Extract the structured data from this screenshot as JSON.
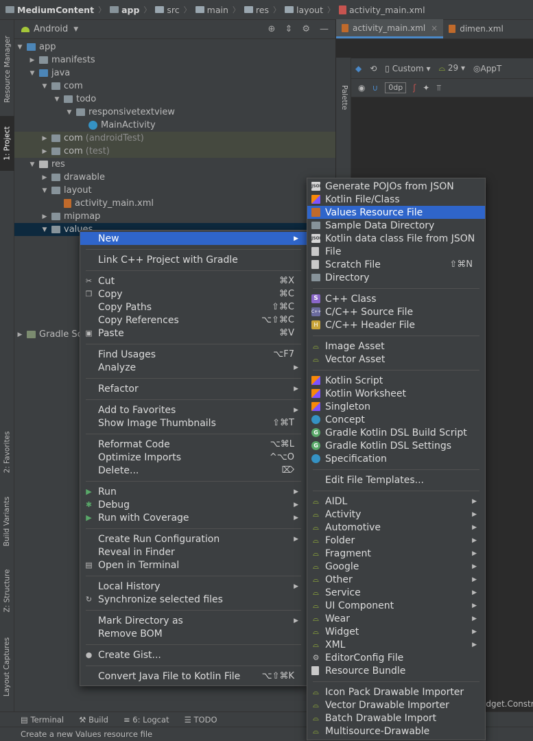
{
  "breadcrumb": [
    "MediumContent",
    "app",
    "src",
    "main",
    "res",
    "layout",
    "activity_main.xml"
  ],
  "project_panel": {
    "view_mode": "Android",
    "tree": [
      {
        "label": "app",
        "depth": 0,
        "expanded": true,
        "icon": "folder-blue"
      },
      {
        "label": "manifests",
        "depth": 1,
        "expanded": false,
        "icon": "folder"
      },
      {
        "label": "java",
        "depth": 1,
        "expanded": true,
        "icon": "folder-blue"
      },
      {
        "label": "com",
        "depth": 2,
        "expanded": true,
        "icon": "folder"
      },
      {
        "label": "todo",
        "depth": 3,
        "expanded": true,
        "icon": "folder"
      },
      {
        "label": "responsivetextview",
        "depth": 4,
        "expanded": true,
        "icon": "folder"
      },
      {
        "label": "MainActivity",
        "depth": 5,
        "icon": "class"
      },
      {
        "label": "com",
        "suffix": "(androidTest)",
        "depth": 2,
        "expanded": false,
        "icon": "folder",
        "state": "test"
      },
      {
        "label": "com",
        "suffix": "(test)",
        "depth": 2,
        "expanded": false,
        "icon": "folder",
        "state": "test"
      },
      {
        "label": "res",
        "depth": 1,
        "expanded": true,
        "icon": "res"
      },
      {
        "label": "drawable",
        "depth": 2,
        "expanded": false,
        "icon": "folder"
      },
      {
        "label": "layout",
        "depth": 2,
        "expanded": true,
        "icon": "folder"
      },
      {
        "label": "activity_main.xml",
        "depth": 3,
        "icon": "xml"
      },
      {
        "label": "mipmap",
        "depth": 2,
        "expanded": false,
        "icon": "folder"
      },
      {
        "label": "values",
        "depth": 2,
        "expanded": true,
        "icon": "folder",
        "state": "selected"
      }
    ],
    "gradle_label": "Gradle Sc"
  },
  "left_stripe": {
    "resource_manager": "Resource Manager",
    "project": "1: Project",
    "favorites": "2: Favorites",
    "build_variants": "Build Variants",
    "structure": "Z: Structure",
    "layout_captures": "Layout Captures"
  },
  "editor": {
    "tabs": [
      "activity_main.xml",
      "dimen.xml"
    ],
    "palette_label": "Palette",
    "device_label": "Custom",
    "api_label": "29",
    "theme_label": "AppT",
    "dp_value": "0dp",
    "constraint_text": "idget.Constra"
  },
  "context_menu": {
    "items": [
      {
        "label": "New",
        "arrow": true,
        "highlighted": true
      },
      {
        "sep": true
      },
      {
        "label": "Link C++ Project with Gradle"
      },
      {
        "sep": true
      },
      {
        "label": "Cut",
        "shortcut": "⌘X",
        "icon": "scissors-icon",
        "glyph": "✂"
      },
      {
        "label": "Copy",
        "shortcut": "⌘C",
        "icon": "copy-icon",
        "glyph": "❐"
      },
      {
        "label": "Copy Paths",
        "shortcut": "⇧⌘C"
      },
      {
        "label": "Copy References",
        "shortcut": "⌥⇧⌘C"
      },
      {
        "label": "Paste",
        "shortcut": "⌘V",
        "icon": "paste-icon",
        "glyph": "▣"
      },
      {
        "sep": true
      },
      {
        "label": "Find Usages",
        "shortcut": "⌥F7"
      },
      {
        "label": "Analyze",
        "arrow": true
      },
      {
        "sep": true
      },
      {
        "label": "Refactor",
        "arrow": true
      },
      {
        "sep": true
      },
      {
        "label": "Add to Favorites",
        "arrow": true
      },
      {
        "label": "Show Image Thumbnails",
        "shortcut": "⇧⌘T"
      },
      {
        "sep": true
      },
      {
        "label": "Reformat Code",
        "shortcut": "⌥⌘L"
      },
      {
        "label": "Optimize Imports",
        "shortcut": "^⌥O"
      },
      {
        "label": "Delete...",
        "shortcut": "⌦"
      },
      {
        "sep": true
      },
      {
        "label": "Run",
        "arrow": true,
        "icon": "run-icon",
        "glyph": "▶",
        "iconClass": "green"
      },
      {
        "label": "Debug",
        "arrow": true,
        "icon": "debug-icon",
        "glyph": "✱",
        "iconClass": "green"
      },
      {
        "label": "Run with Coverage",
        "arrow": true,
        "icon": "coverage-icon",
        "glyph": "▶",
        "iconClass": "green"
      },
      {
        "sep": true
      },
      {
        "label": "Create Run Configuration",
        "arrow": true
      },
      {
        "label": "Reveal in Finder"
      },
      {
        "label": "Open in Terminal",
        "icon": "terminal-icon",
        "glyph": "▤"
      },
      {
        "sep": true
      },
      {
        "label": "Local History",
        "arrow": true
      },
      {
        "label": "Synchronize selected files",
        "icon": "sync-icon",
        "glyph": "↻"
      },
      {
        "sep": true
      },
      {
        "label": "Mark Directory as",
        "arrow": true
      },
      {
        "label": "Remove BOM"
      },
      {
        "sep": true
      },
      {
        "label": "Create Gist...",
        "icon": "github-icon",
        "glyph": "●"
      },
      {
        "sep": true
      },
      {
        "label": "Convert Java File to Kotlin File",
        "shortcut": "⌥⇧⌘K"
      }
    ]
  },
  "new_submenu": {
    "items": [
      {
        "label": "Generate POJOs from JSON",
        "icon": "json-icon",
        "iconClass": "json",
        "glyph": "JSON"
      },
      {
        "label": "Kotlin File/Class",
        "icon": "kotlin-icon",
        "iconClass": "kotlin"
      },
      {
        "label": "Values Resource File",
        "icon": "xml-file-icon",
        "iconClass": "xml",
        "highlighted": true
      },
      {
        "label": "Sample Data Directory",
        "icon": "folder-icon",
        "iconClass": "folder"
      },
      {
        "label": "Kotlin data class File from JSON",
        "icon": "kotlin-json-icon",
        "iconClass": "json",
        "glyph": "JSON"
      },
      {
        "label": "File",
        "icon": "file-icon",
        "iconClass": "file"
      },
      {
        "label": "Scratch File",
        "shortcut": "⇧⌘N",
        "icon": "scratch-file-icon",
        "iconClass": "file"
      },
      {
        "label": "Directory",
        "icon": "folder-icon",
        "iconClass": "folder"
      },
      {
        "sep": true
      },
      {
        "label": "C++ Class",
        "icon": "cpp-class-icon",
        "iconClass": "s",
        "glyph": "S"
      },
      {
        "label": "C/C++ Source File",
        "icon": "cpp-source-icon",
        "iconClass": "cpp",
        "glyph": "C++"
      },
      {
        "label": "C/C++ Header File",
        "icon": "cpp-header-icon",
        "iconClass": "h",
        "glyph": "H"
      },
      {
        "sep": true
      },
      {
        "label": "Image Asset",
        "icon": "android-icon",
        "iconClass": "android",
        "glyph": "⌓"
      },
      {
        "label": "Vector Asset",
        "icon": "android-icon",
        "iconClass": "android",
        "glyph": "⌓"
      },
      {
        "sep": true
      },
      {
        "label": "Kotlin Script",
        "icon": "kotlin-icon",
        "iconClass": "kotlin"
      },
      {
        "label": "Kotlin Worksheet",
        "icon": "kotlin-icon",
        "iconClass": "kotlin"
      },
      {
        "label": "Singleton",
        "icon": "kotlin-icon",
        "iconClass": "kotlin"
      },
      {
        "label": "Concept",
        "icon": "concept-icon",
        "iconClass": "circle-blue"
      },
      {
        "label": "Gradle Kotlin DSL Build Script",
        "icon": "gradle-icon",
        "iconClass": "circle-green",
        "glyph": "G"
      },
      {
        "label": "Gradle Kotlin DSL Settings",
        "icon": "gradle-icon",
        "iconClass": "circle-green",
        "glyph": "G"
      },
      {
        "label": "Specification",
        "icon": "concept-icon",
        "iconClass": "circle-blue"
      },
      {
        "sep": true
      },
      {
        "label": "Edit File Templates..."
      },
      {
        "sep": true
      },
      {
        "label": "AIDL",
        "arrow": true,
        "icon": "android-icon",
        "iconClass": "android",
        "glyph": "⌓"
      },
      {
        "label": "Activity",
        "arrow": true,
        "icon": "android-icon",
        "iconClass": "android",
        "glyph": "⌓"
      },
      {
        "label": "Automotive",
        "arrow": true,
        "icon": "android-icon",
        "iconClass": "android",
        "glyph": "⌓"
      },
      {
        "label": "Folder",
        "arrow": true,
        "icon": "android-icon",
        "iconClass": "android",
        "glyph": "⌓"
      },
      {
        "label": "Fragment",
        "arrow": true,
        "icon": "android-icon",
        "iconClass": "android",
        "glyph": "⌓"
      },
      {
        "label": "Google",
        "arrow": true,
        "icon": "android-icon",
        "iconClass": "android",
        "glyph": "⌓"
      },
      {
        "label": "Other",
        "arrow": true,
        "icon": "android-icon",
        "iconClass": "android",
        "glyph": "⌓"
      },
      {
        "label": "Service",
        "arrow": true,
        "icon": "android-icon",
        "iconClass": "android",
        "glyph": "⌓"
      },
      {
        "label": "UI Component",
        "arrow": true,
        "icon": "android-icon",
        "iconClass": "android",
        "glyph": "⌓"
      },
      {
        "label": "Wear",
        "arrow": true,
        "icon": "android-icon",
        "iconClass": "android",
        "glyph": "⌓"
      },
      {
        "label": "Widget",
        "arrow": true,
        "icon": "android-icon",
        "iconClass": "android",
        "glyph": "⌓"
      },
      {
        "label": "XML",
        "arrow": true,
        "icon": "android-icon",
        "iconClass": "android",
        "glyph": "⌓"
      },
      {
        "label": "EditorConfig File",
        "icon": "gear-icon",
        "glyph": "⚙"
      },
      {
        "label": "Resource Bundle",
        "icon": "resource-bundle-icon",
        "iconClass": "file"
      },
      {
        "sep": true
      },
      {
        "label": "Icon Pack Drawable Importer",
        "icon": "android-icon",
        "iconClass": "android",
        "glyph": "⌓"
      },
      {
        "label": "Vector Drawable Importer",
        "icon": "android-icon",
        "iconClass": "android",
        "glyph": "⌓"
      },
      {
        "label": "Batch Drawable Import",
        "icon": "android-icon",
        "iconClass": "android",
        "glyph": "⌓"
      },
      {
        "label": "Multisource-Drawable",
        "icon": "android-icon",
        "iconClass": "android",
        "glyph": "⌓"
      }
    ]
  },
  "bottom_tools": {
    "terminal": "Terminal",
    "build": "Build",
    "logcat": "6: Logcat",
    "todo": "TODO"
  },
  "status_bar": {
    "text": "Create a new Values resource file"
  },
  "colors": {
    "highlight": "#2f65ca",
    "panel": "#3c3f41",
    "editor": "#2b2b2b"
  }
}
